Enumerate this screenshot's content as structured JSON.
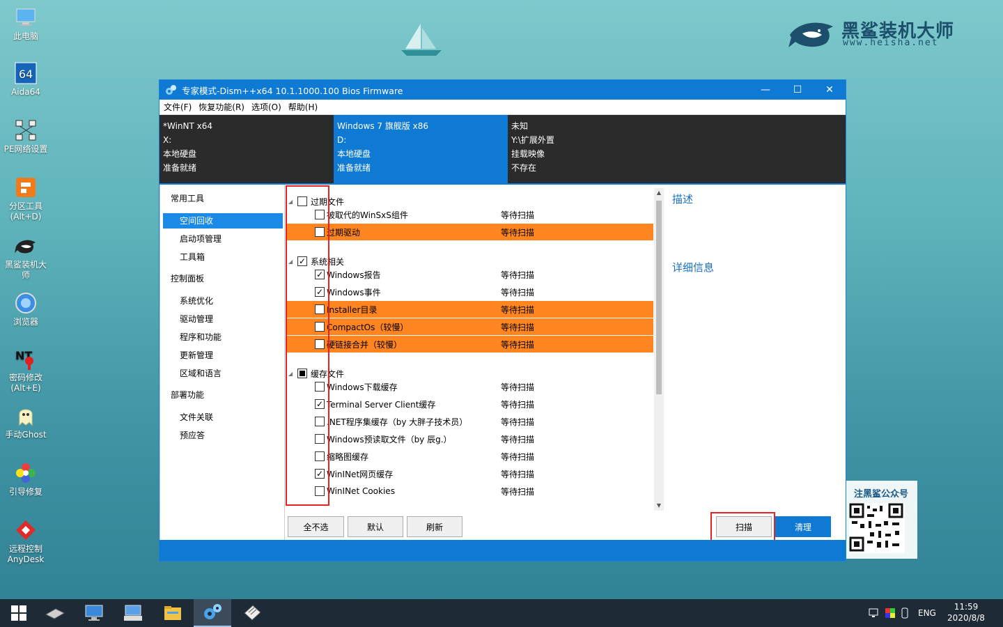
{
  "desktop": {
    "brand": {
      "name": "黑鲨装机大师",
      "url": "www.heisha.net"
    },
    "qr_caption": "注黑鲨公众号",
    "icons": [
      {
        "label": "此电脑",
        "icon": "computer-icon"
      },
      {
        "label": "Aida64",
        "icon": "aida64-icon"
      },
      {
        "label": "PE网络设置",
        "icon": "network-icon"
      },
      {
        "label": "分区工具\n(Alt+D)",
        "icon": "partition-tool-icon"
      },
      {
        "label": "黑鲨装机大\n师",
        "icon": "heisha-icon"
      },
      {
        "label": "浏览器",
        "icon": "browser-icon"
      },
      {
        "label": "密码修改\n(Alt+E)",
        "icon": "password-icon"
      },
      {
        "label": "手动Ghost",
        "icon": "ghost-icon"
      },
      {
        "label": "引导修复",
        "icon": "boot-repair-icon"
      },
      {
        "label": "远程控制\nAnyDesk",
        "icon": "anydesk-icon"
      }
    ]
  },
  "window": {
    "title": "专家模式-Dism++x64 10.1.1000.100 Bios Firmware",
    "controls": {
      "minimize": "—",
      "maximize": "☐",
      "close": "✕"
    },
    "menu": [
      "文件(F)",
      "恢复功能(R)",
      "选项(O)",
      "帮助(H)"
    ],
    "systems": [
      {
        "lines": [
          "*WinNT x64",
          "X:",
          "本地硬盘",
          "准备就绪"
        ],
        "active": false
      },
      {
        "lines": [
          "Windows 7 旗舰版 x86",
          "D:",
          "本地硬盘",
          "准备就绪"
        ],
        "active": true
      },
      {
        "lines": [
          "未知",
          "Y:\\扩展外置",
          "挂载映像",
          "不存在"
        ],
        "active": false
      }
    ],
    "nav": {
      "sections": [
        {
          "title": "常用工具",
          "items": [
            "空间回收",
            "启动项管理",
            "工具箱"
          ]
        },
        {
          "title": "控制面板",
          "items": [
            "系统优化",
            "驱动管理",
            "程序和功能",
            "更新管理",
            "区域和语言"
          ]
        },
        {
          "title": "部署功能",
          "items": [
            "文件关联",
            "预应答"
          ]
        }
      ],
      "selected": "空间回收"
    },
    "list": {
      "groups": [
        {
          "label": "过期文件",
          "state": "unchecked",
          "items": [
            {
              "label": "被取代的WinSxS组件",
              "status": "等待扫描",
              "checked": false,
              "highlight": false
            },
            {
              "label": "过期驱动",
              "status": "等待扫描",
              "checked": false,
              "highlight": true
            }
          ]
        },
        {
          "label": "系统相关",
          "state": "checked",
          "items": [
            {
              "label": "Windows报告",
              "status": "等待扫描",
              "checked": true,
              "highlight": false
            },
            {
              "label": "Windows事件",
              "status": "等待扫描",
              "checked": true,
              "highlight": false
            },
            {
              "label": "Installer目录",
              "status": "等待扫描",
              "checked": false,
              "highlight": true
            },
            {
              "label": "CompactOs（较慢）",
              "status": "等待扫描",
              "checked": false,
              "highlight": true
            },
            {
              "label": "硬链接合并（较慢）",
              "status": "等待扫描",
              "checked": false,
              "highlight": true
            }
          ]
        },
        {
          "label": "缓存文件",
          "state": "partial",
          "items": [
            {
              "label": "Windows下载缓存",
              "status": "等待扫描",
              "checked": false,
              "highlight": false
            },
            {
              "label": "Terminal Server Client缓存",
              "status": "等待扫描",
              "checked": true,
              "highlight": false
            },
            {
              "label": ".NET程序集缓存（by 大胖子技术员）",
              "status": "等待扫描",
              "checked": false,
              "highlight": false
            },
            {
              "label": "Windows预读取文件（by 辰g.）",
              "status": "等待扫描",
              "checked": false,
              "highlight": false
            },
            {
              "label": "缩略图缓存",
              "status": "等待扫描",
              "checked": false,
              "highlight": false
            },
            {
              "label": "WinINet网页缓存",
              "status": "等待扫描",
              "checked": true,
              "highlight": false
            },
            {
              "label": "WinINet Cookies",
              "status": "等待扫描",
              "checked": false,
              "highlight": false
            }
          ]
        }
      ]
    },
    "side": {
      "desc_title": "描述",
      "detail_title": "详细信息"
    },
    "buttons": {
      "select_none": "全不选",
      "default": "默认",
      "refresh": "刷新",
      "scan": "扫描",
      "clean": "清理"
    }
  },
  "taskbar": {
    "items": [
      "start-icon",
      "disk-tool-icon",
      "computer-manage-icon",
      "keyboard-icon",
      "file-explorer-icon",
      "dism-gear-icon",
      "imaging-tool-icon"
    ],
    "active": "dism-gear-icon",
    "tray": {
      "lang": "ENG",
      "time": "11:59",
      "date": "2020/8/8"
    }
  }
}
